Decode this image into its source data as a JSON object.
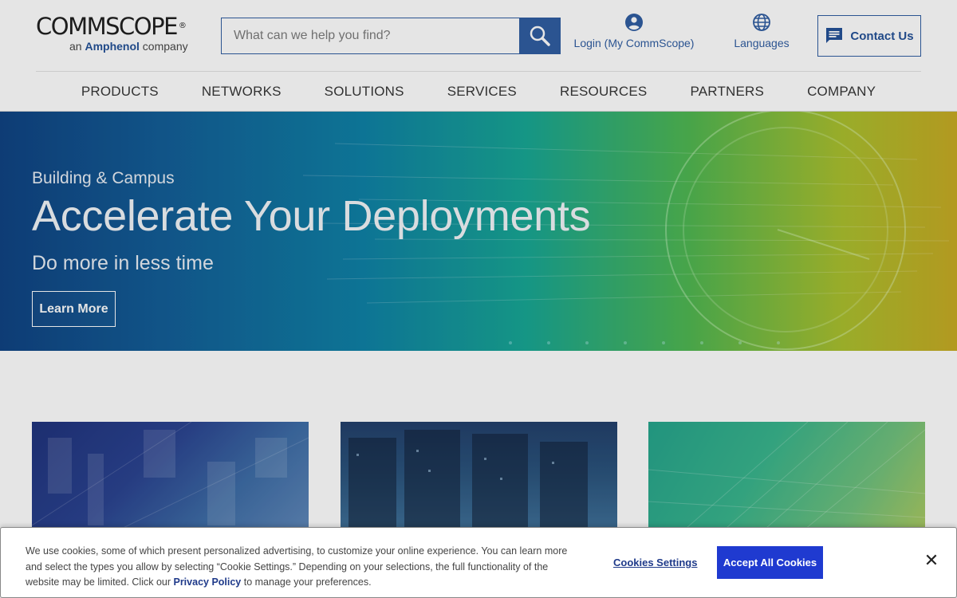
{
  "header": {
    "logo_text": "COMMSCOPE",
    "logo_reg": "®",
    "logo_sub_prefix": "an ",
    "logo_sub_brand": "Amphenol",
    "logo_sub_suffix": " company",
    "search_placeholder": "What can we help you find?",
    "login_label": "Login (My CommScope)",
    "languages_label": "Languages",
    "contact_label": "Contact Us",
    "icons": {
      "search": "search-icon",
      "login": "user-circle-icon",
      "languages": "globe-icon",
      "contact": "chat-icon"
    }
  },
  "nav": {
    "items": [
      {
        "label": "PRODUCTS"
      },
      {
        "label": "NETWORKS"
      },
      {
        "label": "SOLUTIONS"
      },
      {
        "label": "SERVICES"
      },
      {
        "label": "RESOURCES"
      },
      {
        "label": "PARTNERS"
      },
      {
        "label": "COMPANY"
      }
    ]
  },
  "hero": {
    "eyebrow": "Building & Campus",
    "title": "Accelerate Your Deployments",
    "subtitle": "Do more in less time",
    "cta_label": "Learn More"
  },
  "cookie": {
    "text_1": "We use cookies, some of which present personalized advertising, to customize your online experience. You can learn more and select the types you allow by selecting “Cookie Settings.” Depending on your selections, the full functionality of the website may be limited. Click our ",
    "privacy_link": "Privacy Policy",
    "text_2": " to manage your preferences.",
    "settings_label": "Cookies Settings",
    "accept_label": "Accept All Cookies",
    "close_label": "✕"
  },
  "colors": {
    "brand_blue": "#2c5aa0",
    "accept_blue": "#1f3ad0",
    "link_navy": "#1f3a8a"
  }
}
